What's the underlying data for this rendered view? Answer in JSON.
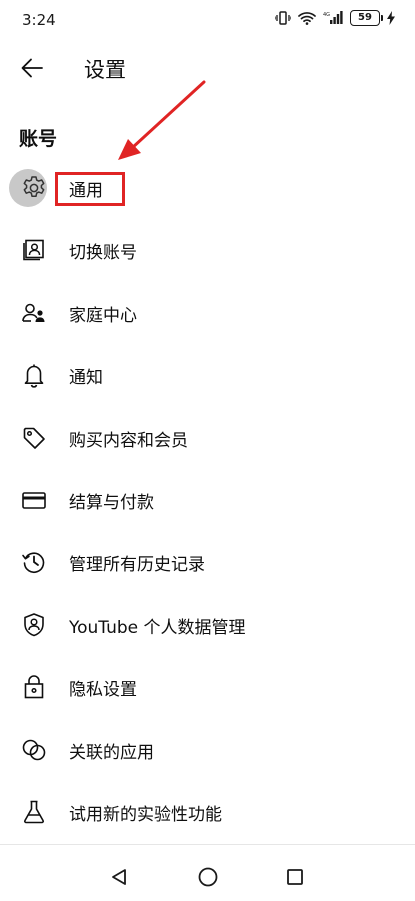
{
  "status_bar": {
    "time": "3:24",
    "battery_level": "59"
  },
  "header": {
    "title": "设置"
  },
  "section": {
    "title": "账号"
  },
  "menu": {
    "items": [
      {
        "icon": "gear-icon",
        "label": "通用"
      },
      {
        "icon": "switch-account-icon",
        "label": "切换账号"
      },
      {
        "icon": "family-center-icon",
        "label": "家庭中心"
      },
      {
        "icon": "bell-icon",
        "label": "通知"
      },
      {
        "icon": "tag-icon",
        "label": "购买内容和会员"
      },
      {
        "icon": "credit-card-icon",
        "label": "结算与付款"
      },
      {
        "icon": "history-icon",
        "label": "管理所有历史记录"
      },
      {
        "icon": "shield-person-icon",
        "label": "YouTube 个人数据管理"
      },
      {
        "icon": "lock-icon",
        "label": "隐私设置"
      },
      {
        "icon": "linked-apps-icon",
        "label": "关联的应用"
      },
      {
        "icon": "flask-icon",
        "label": "试用新的实验性功能"
      }
    ]
  },
  "annotation": {
    "color": "#e02424"
  }
}
